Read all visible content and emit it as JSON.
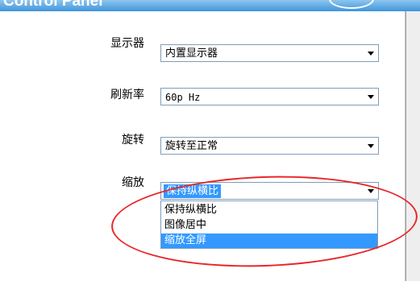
{
  "window": {
    "title": "Control Panel",
    "title_bar_color": "#3f95dc"
  },
  "settings": {
    "display": {
      "label": "显示器",
      "value": "内置显示器"
    },
    "refresh": {
      "label": "刷新率",
      "value": "60p Hz"
    },
    "rotation": {
      "label": "旋转",
      "value": "旋转至正常"
    },
    "scaling": {
      "label": "缩放",
      "value": "保持纵横比",
      "open": true,
      "options": [
        {
          "label": "保持纵横比",
          "selected": false
        },
        {
          "label": "图像居中",
          "selected": false
        },
        {
          "label": "缩放全屏",
          "selected": true
        }
      ]
    }
  },
  "colors": {
    "selection": "#3399ff",
    "annotation": "#e8262a"
  }
}
